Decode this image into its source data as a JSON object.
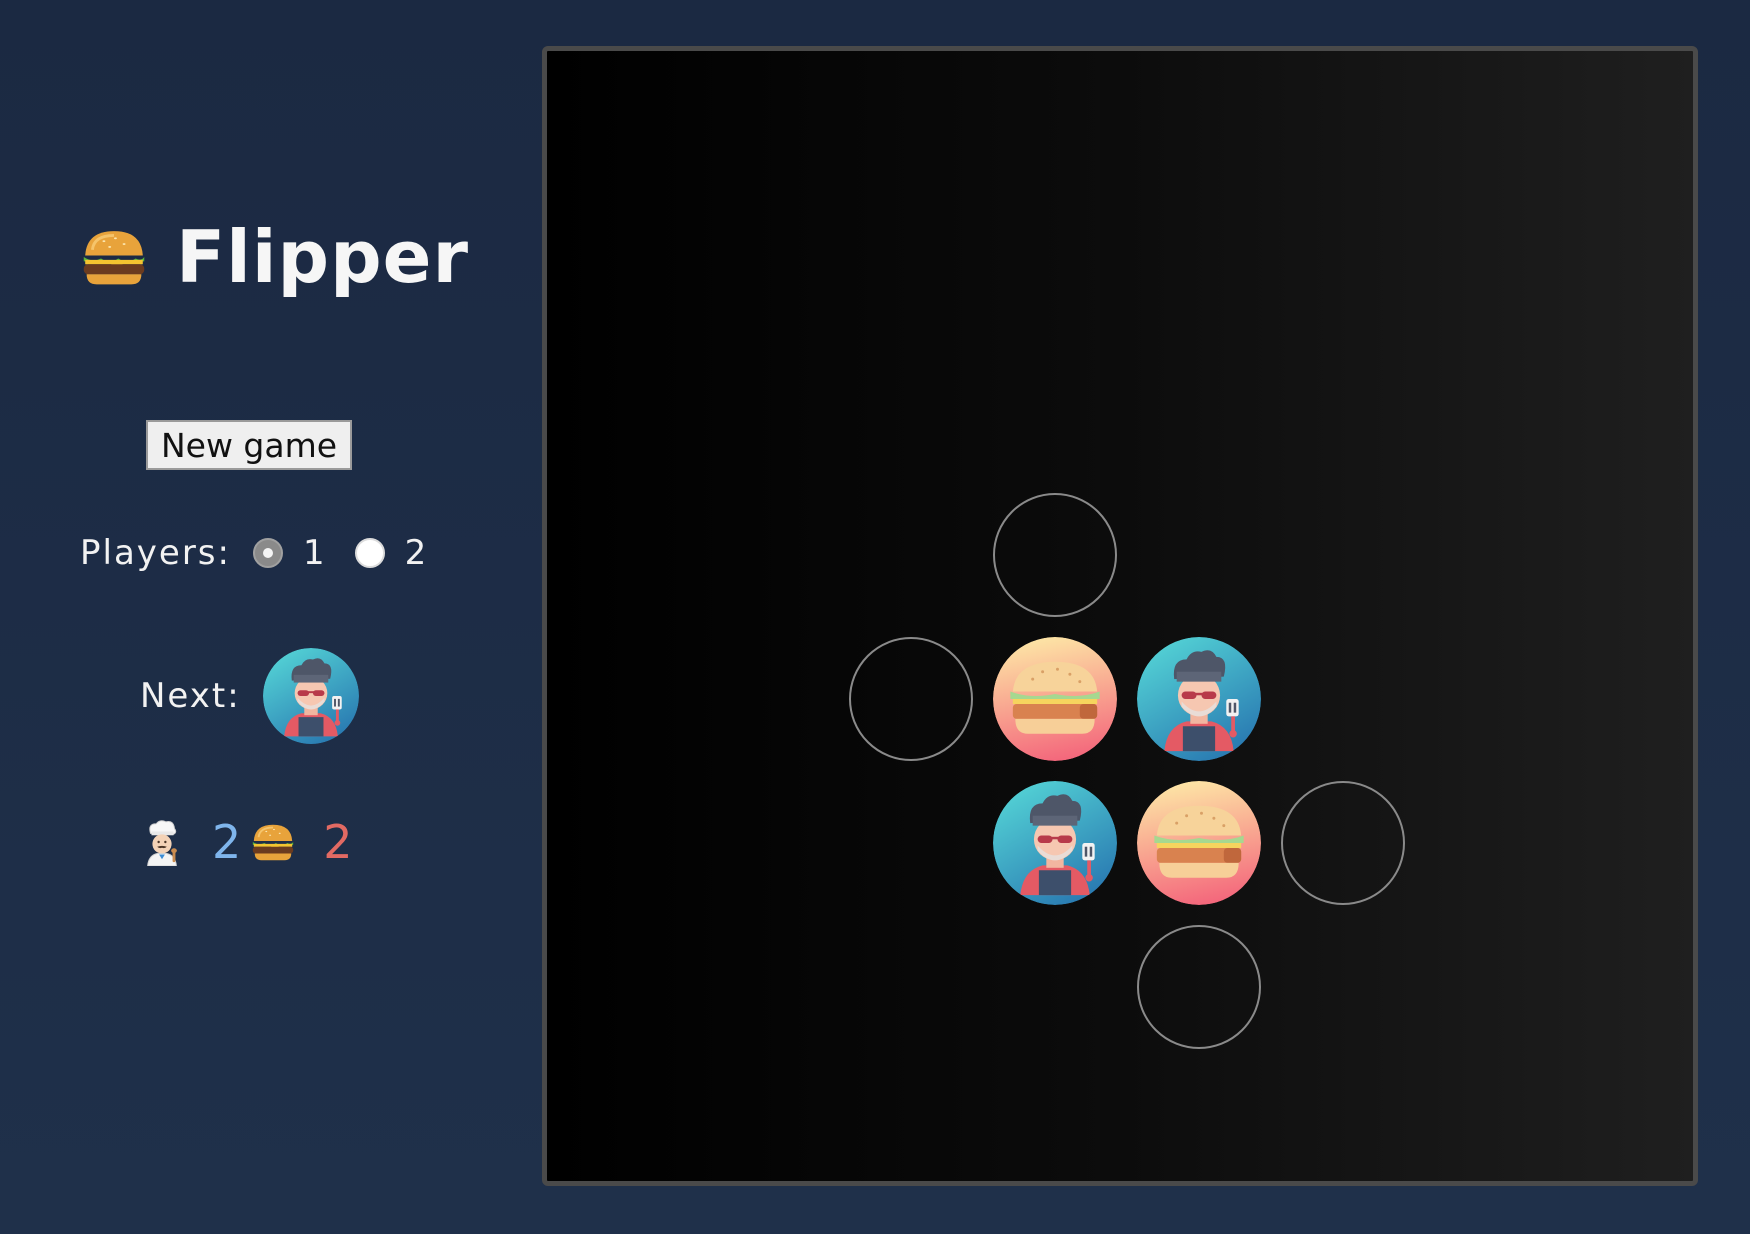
{
  "app": {
    "title": "Flipper",
    "logo_icon": "burger-icon"
  },
  "controls": {
    "new_game_label": "New game",
    "players_label": "Players:",
    "player_options": [
      {
        "label": "1",
        "selected": true
      },
      {
        "label": "2",
        "selected": false
      }
    ],
    "next_label": "Next:",
    "next_piece": "chef"
  },
  "score": {
    "chef_icon": "chef-icon",
    "chef_value": "2",
    "chef_color": "#7fb5ec",
    "burger_icon": "burger-icon",
    "burger_value": "2",
    "burger_color": "#e26a63"
  },
  "board": {
    "pieces": [
      {
        "row": 4,
        "col": 3,
        "type": "burger"
      },
      {
        "row": 4,
        "col": 4,
        "type": "chef"
      },
      {
        "row": 5,
        "col": 3,
        "type": "chef"
      },
      {
        "row": 5,
        "col": 4,
        "type": "burger"
      }
    ],
    "valid_moves": [
      {
        "row": 3,
        "col": 3
      },
      {
        "row": 4,
        "col": 2
      },
      {
        "row": 5,
        "col": 5
      },
      {
        "row": 6,
        "col": 4
      }
    ]
  },
  "colors": {
    "chef_piece_gradient": [
      "#4fd3d7",
      "#2f83b5"
    ],
    "burger_piece_gradient": [
      "#fde0a0",
      "#f46b7e"
    ]
  }
}
